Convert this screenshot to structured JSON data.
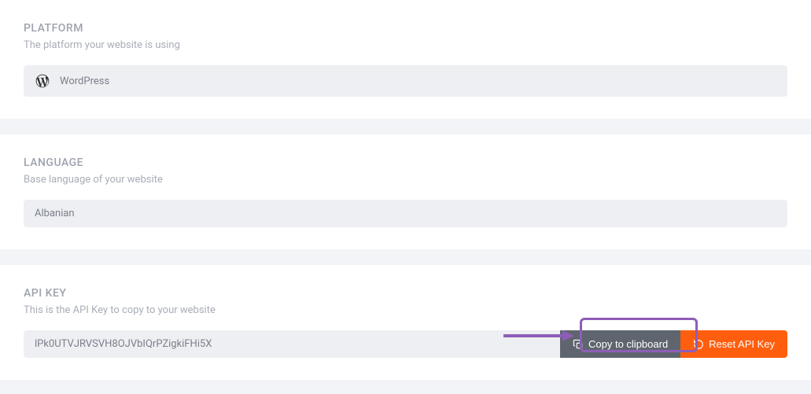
{
  "platform": {
    "label": "PLATFORM",
    "description": "The platform your website is using",
    "value": "WordPress",
    "icon": "wordpress-icon"
  },
  "language": {
    "label": "LANGUAGE",
    "description": "Base language of your website",
    "value": "Albanian"
  },
  "apiKey": {
    "label": "API KEY",
    "description": "This is the API Key to copy to your website",
    "value": "lPk0UTVJRVSVH8OJVbIQrPZigkiFHi5X",
    "copyLabel": "Copy to clipboard",
    "resetLabel": "Reset API Key"
  },
  "annotation": {
    "highlight": "copy-to-clipboard-button"
  }
}
